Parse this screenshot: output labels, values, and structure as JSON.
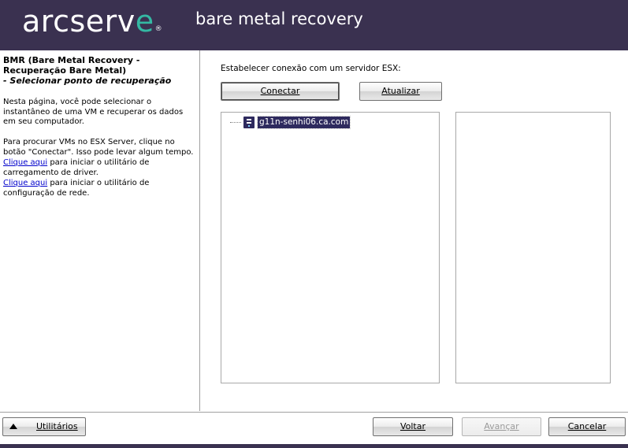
{
  "header": {
    "logo_main": "arcserv",
    "logo_accent": "e",
    "logo_mark": "®",
    "product_name": "bare metal recovery"
  },
  "left_pane": {
    "title": "BMR (Bare Metal Recovery - Recuperação Bare Metal)",
    "subtitle": " - Selecionar ponto de recuperação",
    "description": "Nesta página, você pode selecionar o instantâneo de uma VM e recuperar os dados em seu computador.",
    "search_hint": "Para procurar VMs no ESX Server, clique no botão \"Conectar\". Isso pode levar algum tempo.",
    "driver_link": "Clique aqui",
    "driver_text": " para iniciar o utilitário de carregamento de driver.",
    "network_link": "Clique aqui",
    "network_text": " para iniciar o utilitário de configuração de rede."
  },
  "main": {
    "esx_label": "Estabelecer conexão com um servidor ESX:",
    "connect_label": "Conectar",
    "refresh_label": "Atualizar",
    "tree": [
      {
        "label": "g11n-senhi06.ca.com",
        "icon": "server-icon",
        "selected": true
      }
    ]
  },
  "footer": {
    "utilities_label": "Utilitários",
    "back_label": "Voltar",
    "next_label": "Avançar",
    "cancel_label": "Cancelar"
  },
  "colors": {
    "header_bg": "#3a3150",
    "logo_accent": "#34b8a3",
    "selection": "#2e2a5e",
    "link": "#0000cc"
  }
}
